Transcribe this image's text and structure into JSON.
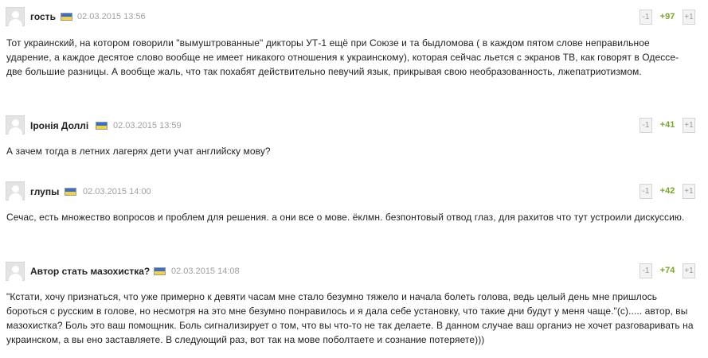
{
  "colors": {
    "score": "#7aa62b",
    "date": "#a0a0a0",
    "flag_blue": "#3a6fd1",
    "flag_yellow": "#f3d23a"
  },
  "icons": {
    "avatar": "user-silhouette-icon",
    "flag": "ukraine-flag-icon"
  },
  "comments": [
    {
      "author": "гость",
      "date": "02.03.2015 13:56",
      "minus": "-1",
      "score": "+97",
      "plus": "+1",
      "text": "Тот украинский, на котором говорили \"вымуштрованные\" дикторы УТ-1 ещё при Союзе и та быдломова ( в каждом пятом слове неправильное ударение, а каждое десятое слово вообще не имеет никакого отношения к украинскому), которая сейчас льется с экранов ТВ, как говорят в Одессе- две большие разницы. А вообще жаль, что так похабят действительно певучий язык, прикрывая свою необразованность, лжепатриотизмом."
    },
    {
      "author": "Іронія Доллі",
      "date": "02.03.2015 13:59",
      "minus": "-1",
      "score": "+41",
      "plus": "+1",
      "text": "А зачем тогда в летних лагерях дети учат английску мову?"
    },
    {
      "author": "глупы",
      "date": "02.03.2015 14:00",
      "minus": "-1",
      "score": "+42",
      "plus": "+1",
      "text": "Сечас, есть множество вопросов и проблем для решения. а они все о мове. ёклмн. безпонтовый отвод глаз, для рахитов что тут устроили дискуссию."
    },
    {
      "author": "Автор стать мазохистка?",
      "date": "02.03.2015 14:08",
      "minus": "-1",
      "score": "+74",
      "plus": "+1",
      "text": "\"Кстати, хочу признаться, что уже примерно к девяти часам мне стало безумно тяжело и начала болеть голова, ведь целый день мне пришлось бороться с русским в голове, но несмотря на это мне безумно понравилось и я дала себе установку, что такие дни будут у меня чаще.\"(с)..... автор, вы мазохистка? Боль это ваш помощник. Боль сигнализирует о том, что вы что-то не так делаете. В данном случае ваш органиэ не хочет разговаривать на украинском, а вы ено заставляете. В следующий раз, вот так на мове поболтаете и сознание потеряете)))"
    }
  ]
}
